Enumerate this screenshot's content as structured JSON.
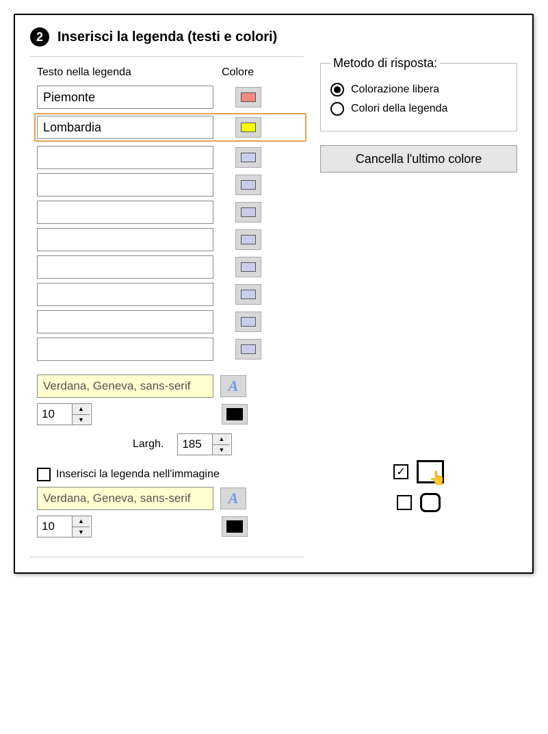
{
  "step_number": "2",
  "section_title": "Inserisci la legenda (testi e colori)",
  "headers": {
    "text": "Testo nella legenda",
    "color": "Colore"
  },
  "legend_items": [
    {
      "text": "Piemonte",
      "color": "#f28b82",
      "highlight": false
    },
    {
      "text": "Lombardia",
      "color": "#ffff00",
      "highlight": true
    },
    {
      "text": "",
      "color": "#c9cdec",
      "highlight": false
    },
    {
      "text": "",
      "color": "#c9cdec",
      "highlight": false
    },
    {
      "text": "",
      "color": "#c9cdec",
      "highlight": false
    },
    {
      "text": "",
      "color": "#c9cdec",
      "highlight": false
    },
    {
      "text": "",
      "color": "#c9cdec",
      "highlight": false
    },
    {
      "text": "",
      "color": "#c9cdec",
      "highlight": false
    },
    {
      "text": "",
      "color": "#c9cdec",
      "highlight": false
    },
    {
      "text": "",
      "color": "#c9cdec",
      "highlight": false
    }
  ],
  "font1": {
    "family": "Verdana, Geneva, sans-serif",
    "size": "10",
    "color": "#000000"
  },
  "width": {
    "label": "Largh.",
    "value": "185"
  },
  "insert_in_image": {
    "label": "Inserisci la legenda nell'immagine",
    "checked": false
  },
  "font2": {
    "family": "Verdana, Geneva, sans-serif",
    "size": "10",
    "color": "#000000"
  },
  "response_method": {
    "legend": "Metodo di risposta:",
    "options": [
      {
        "label": "Colorazione libera",
        "selected": true
      },
      {
        "label": "Colori della legenda",
        "selected": false
      }
    ]
  },
  "delete_last_button": "Cancella l'ultimo colore",
  "toggles": {
    "row1_checked": true,
    "row2_checked": false
  }
}
